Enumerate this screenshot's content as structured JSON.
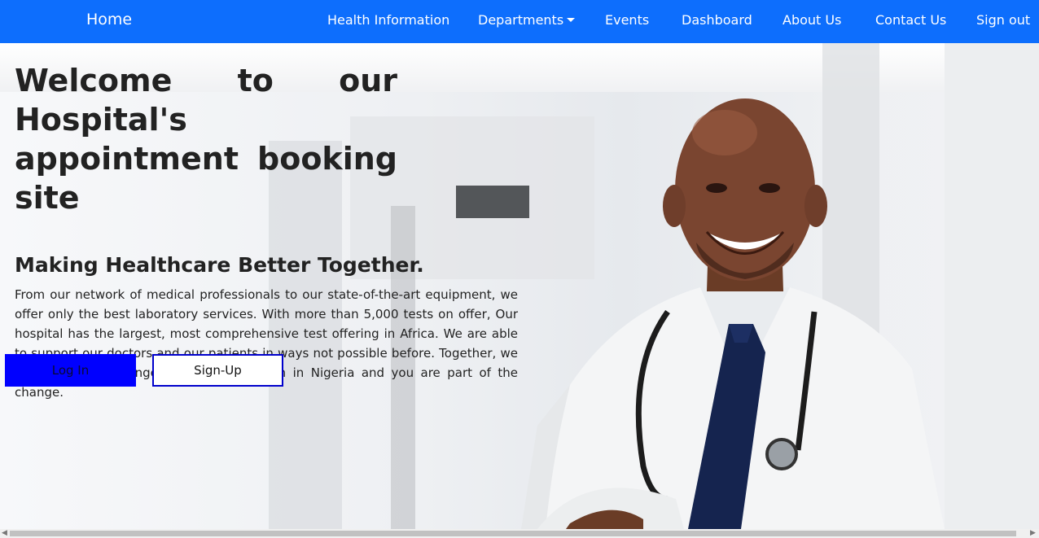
{
  "nav": {
    "brand": "Home",
    "items": [
      {
        "label": "Health Information"
      },
      {
        "label": "Departments"
      },
      {
        "label": "Events"
      },
      {
        "label": "Dashboard"
      },
      {
        "label": "About Us"
      },
      {
        "label": "Contact Us"
      },
      {
        "label": "Sign out"
      }
    ]
  },
  "hero": {
    "title": "Welcome to our Hospital's appointment booking site",
    "subtitle": "Making Healthcare Better Together.",
    "body": "From our network of medical professionals to our state-of-the-art equipment, we offer only the best laboratory services. With more than 5,000 tests on offer, Our hospital has the largest, most comprehensive test offering in Africa. We are able to support our doctors and our patients in ways not possible before. Together, we are building a stronger healthcare system in Nigeria and you are part of the change.",
    "login_label": "Log In",
    "signup_label": "Sign-Up"
  },
  "colors": {
    "navbar": "#0d6efd",
    "login_button": "#0000ff",
    "signup_border": "#0000cc"
  }
}
